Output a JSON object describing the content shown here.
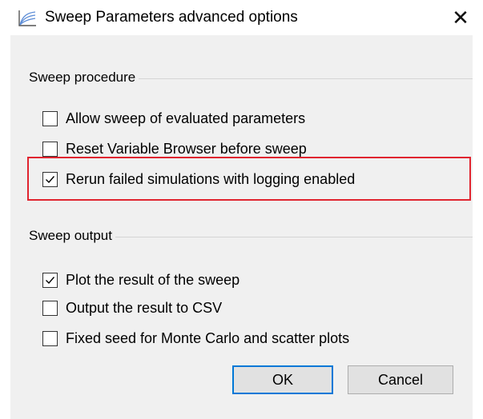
{
  "window": {
    "title": "Sweep Parameters advanced options",
    "close_glyph": "✕",
    "icon": "sweep-chart-icon"
  },
  "groups": [
    {
      "label": "Sweep procedure",
      "options": [
        {
          "label": "Allow sweep of evaluated parameters",
          "checked": false
        },
        {
          "label": "Reset Variable Browser before sweep",
          "checked": false
        },
        {
          "label": "Rerun failed simulations with logging enabled",
          "checked": true
        }
      ]
    },
    {
      "label": "Sweep output",
      "options": [
        {
          "label": "Plot the result of the sweep",
          "checked": true
        },
        {
          "label": "Output the result to CSV",
          "checked": false
        },
        {
          "label": "Fixed seed for Monte Carlo and scatter plots",
          "checked": false
        }
      ]
    }
  ],
  "buttons": {
    "ok": "OK",
    "cancel": "Cancel"
  },
  "colors": {
    "highlight": "#e0242f",
    "default_button_border": "#0078d7"
  }
}
